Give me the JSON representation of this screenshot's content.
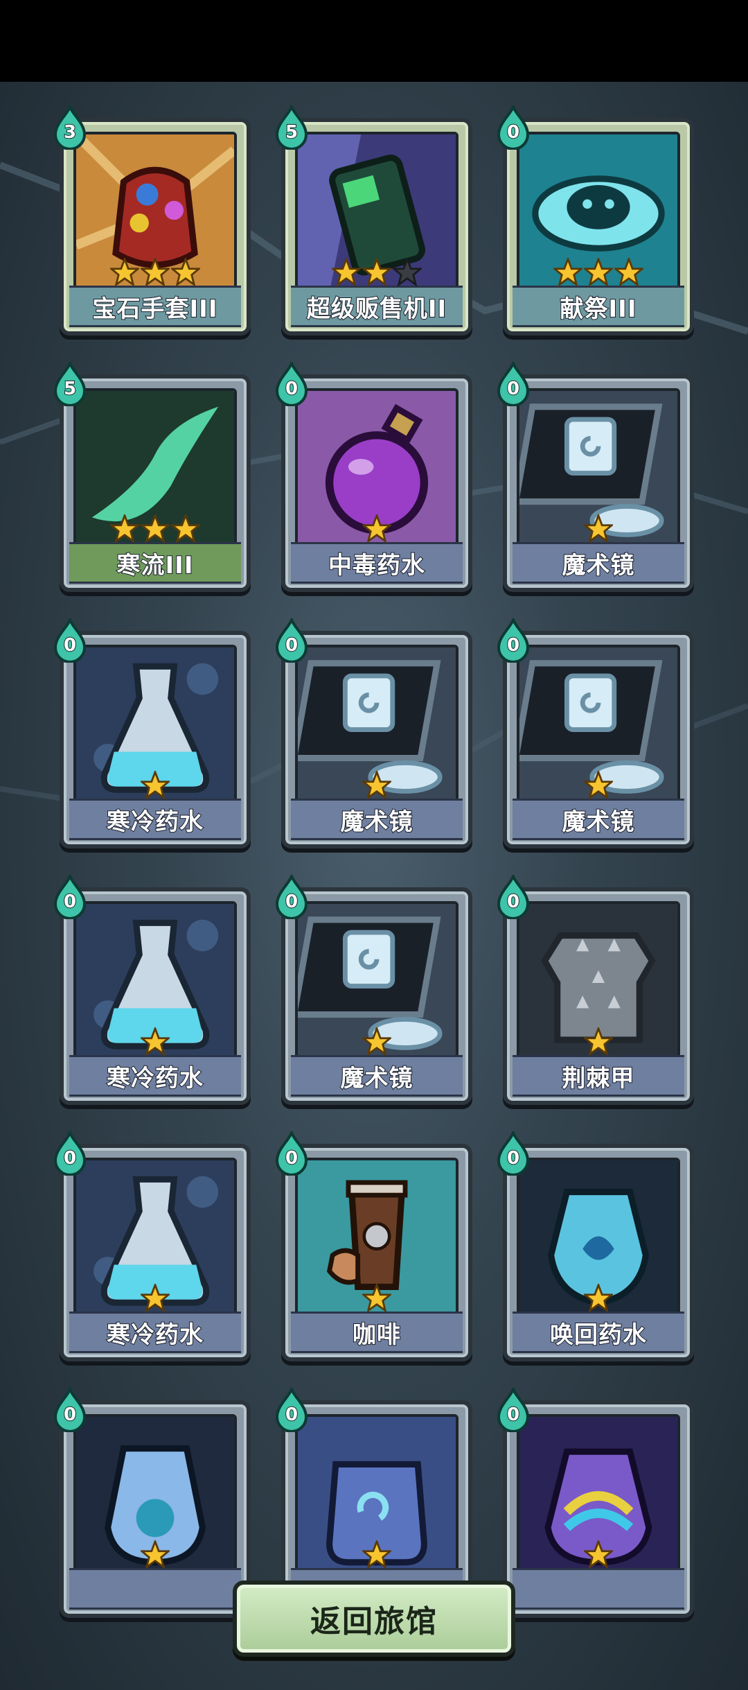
{
  "back_button": {
    "label": "返回旅馆"
  },
  "cards": [
    {
      "name": "宝石手套III",
      "cost": "3",
      "stars": 3,
      "max_stars": 3,
      "art": "gem-gauntlet-art",
      "frame": "gold"
    },
    {
      "name": "超级贩售机II",
      "cost": "5",
      "stars": 2,
      "max_stars": 3,
      "art": "vending-machine-art",
      "frame": "gold"
    },
    {
      "name": "献祭III",
      "cost": "0",
      "stars": 3,
      "max_stars": 3,
      "art": "sacrifice-art",
      "frame": "gold"
    },
    {
      "name": "寒流III",
      "cost": "5",
      "stars": 3,
      "max_stars": 3,
      "art": "cold-current-art",
      "frame": "green"
    },
    {
      "name": "中毒药水",
      "cost": "0",
      "stars": 1,
      "max_stars": 1,
      "art": "poison-potion-art",
      "frame": "blue"
    },
    {
      "name": "魔术镜",
      "cost": "0",
      "stars": 1,
      "max_stars": 1,
      "art": "magic-mirror-art",
      "frame": "blue"
    },
    {
      "name": "寒冷药水",
      "cost": "0",
      "stars": 1,
      "max_stars": 1,
      "art": "frost-potion-art",
      "frame": "blue"
    },
    {
      "name": "魔术镜",
      "cost": "0",
      "stars": 1,
      "max_stars": 1,
      "art": "magic-mirror-art",
      "frame": "blue"
    },
    {
      "name": "魔术镜",
      "cost": "0",
      "stars": 1,
      "max_stars": 1,
      "art": "magic-mirror-art",
      "frame": "blue"
    },
    {
      "name": "寒冷药水",
      "cost": "0",
      "stars": 1,
      "max_stars": 1,
      "art": "frost-potion-art",
      "frame": "blue"
    },
    {
      "name": "魔术镜",
      "cost": "0",
      "stars": 1,
      "max_stars": 1,
      "art": "magic-mirror-art",
      "frame": "blue"
    },
    {
      "name": "荆棘甲",
      "cost": "0",
      "stars": 1,
      "max_stars": 1,
      "art": "thorn-armor-art",
      "frame": "blue"
    },
    {
      "name": "寒冷药水",
      "cost": "0",
      "stars": 1,
      "max_stars": 1,
      "art": "frost-potion-art",
      "frame": "blue"
    },
    {
      "name": "咖啡",
      "cost": "0",
      "stars": 1,
      "max_stars": 1,
      "art": "coffee-art",
      "frame": "blue"
    },
    {
      "name": "唤回药水",
      "cost": "0",
      "stars": 1,
      "max_stars": 1,
      "art": "recall-potion-art",
      "frame": "blue"
    },
    {
      "name": "",
      "cost": "0",
      "stars": 1,
      "max_stars": 1,
      "art": "swirl-potion-art",
      "frame": "blue"
    },
    {
      "name": "",
      "cost": "0",
      "stars": 1,
      "max_stars": 1,
      "art": "swirl-flask-art",
      "frame": "blue"
    },
    {
      "name": "",
      "cost": "0",
      "stars": 1,
      "max_stars": 1,
      "art": "rainbow-potion-art",
      "frame": "blue"
    }
  ]
}
